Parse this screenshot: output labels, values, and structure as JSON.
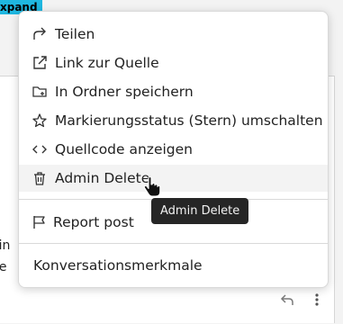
{
  "background": {
    "expand_tag": "xpand",
    "line1": "ein",
    "line2": "de",
    "line3_suffix": "t"
  },
  "menu": {
    "items": [
      {
        "label": "Teilen",
        "icon": "share-icon"
      },
      {
        "label": "Link zur Quelle",
        "icon": "external-link-icon"
      },
      {
        "label": "In Ordner speichern",
        "icon": "folder-add-icon"
      },
      {
        "label": "Markierungsstatus (Stern) umschalten",
        "icon": "star-icon"
      },
      {
        "label": "Quellcode anzeigen",
        "icon": "code-icon"
      },
      {
        "label": "Admin Delete",
        "icon": "trash-icon"
      }
    ],
    "report": {
      "label": "Report post",
      "icon": "flag-icon"
    },
    "conversation": {
      "label": "Konversationsmerkmale"
    }
  },
  "tooltip": {
    "text": "Admin Delete"
  },
  "colors": {
    "accent": "#1fb7e0",
    "tooltip_bg": "#262626",
    "hover_bg": "#f3f3f3"
  }
}
